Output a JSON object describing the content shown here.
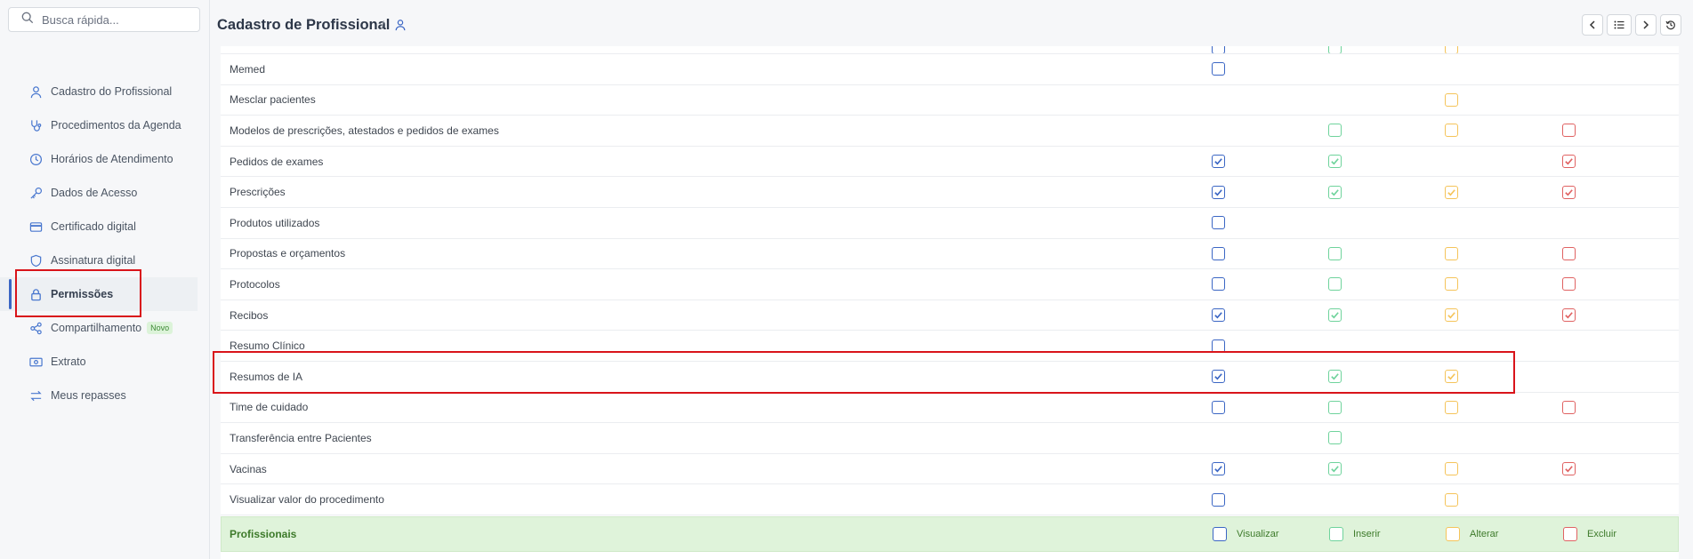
{
  "search": {
    "placeholder": "Busca rápida..."
  },
  "sidebar": {
    "items": [
      {
        "label": "Cadastro do Profissional",
        "icon": "user-icon"
      },
      {
        "label": "Procedimentos da Agenda",
        "icon": "stethoscope-icon"
      },
      {
        "label": "Horários de Atendimento",
        "icon": "clock-icon"
      },
      {
        "label": "Dados de Acesso",
        "icon": "key-icon"
      },
      {
        "label": "Certificado digital",
        "icon": "card-icon"
      },
      {
        "label": "Assinatura digital",
        "icon": "shield-icon"
      },
      {
        "label": "Permissões",
        "icon": "lock-icon",
        "active": true
      },
      {
        "label": "Compartilhamento",
        "icon": "share-icon",
        "badge": "Novo"
      },
      {
        "label": "Extrato",
        "icon": "money-icon"
      },
      {
        "label": "Meus repasses",
        "icon": "transfer-icon"
      }
    ]
  },
  "header": {
    "title": "Cadastro de Profissional",
    "separator": "/"
  },
  "permissions": {
    "columns": [
      "Visualizar",
      "Inserir",
      "Alterar",
      "Excluir"
    ],
    "colors": {
      "visualizar": "#3b66c4",
      "inserir": "#6fd39c",
      "alterar": "#f5c45a",
      "excluir": "#e06262"
    },
    "rows": [
      {
        "label": "",
        "partial": true,
        "cells": [
          false,
          false,
          false,
          null
        ]
      },
      {
        "label": "Memed",
        "cells": [
          false,
          null,
          null,
          null
        ]
      },
      {
        "label": "Mesclar pacientes",
        "cells": [
          null,
          null,
          false,
          null
        ]
      },
      {
        "label": "Modelos de prescrições, atestados e pedidos de exames",
        "cells": [
          null,
          false,
          false,
          false
        ]
      },
      {
        "label": "Pedidos de exames",
        "cells": [
          true,
          true,
          null,
          true
        ]
      },
      {
        "label": "Prescrições",
        "cells": [
          true,
          true,
          true,
          true
        ]
      },
      {
        "label": "Produtos utilizados",
        "cells": [
          false,
          null,
          null,
          null
        ]
      },
      {
        "label": "Propostas e orçamentos",
        "cells": [
          false,
          false,
          false,
          false
        ]
      },
      {
        "label": "Protocolos",
        "cells": [
          false,
          false,
          false,
          false
        ]
      },
      {
        "label": "Recibos",
        "cells": [
          true,
          true,
          true,
          true
        ]
      },
      {
        "label": "Resumo Clínico",
        "cells": [
          false,
          null,
          null,
          null
        ]
      },
      {
        "label": "Resumos de IA",
        "cells": [
          true,
          true,
          true,
          null
        ]
      },
      {
        "label": "Time de cuidado",
        "cells": [
          false,
          false,
          false,
          false
        ]
      },
      {
        "label": "Transferência entre Pacientes",
        "cells": [
          null,
          false,
          null,
          null
        ]
      },
      {
        "label": "Vacinas",
        "cells": [
          true,
          true,
          false,
          true
        ]
      },
      {
        "label": "Visualizar valor do procedimento",
        "cells": [
          false,
          null,
          false,
          null
        ]
      }
    ],
    "group_footer": {
      "label": "Profissionais",
      "legend": [
        "Visualizar",
        "Inserir",
        "Alterar",
        "Excluir"
      ]
    }
  }
}
